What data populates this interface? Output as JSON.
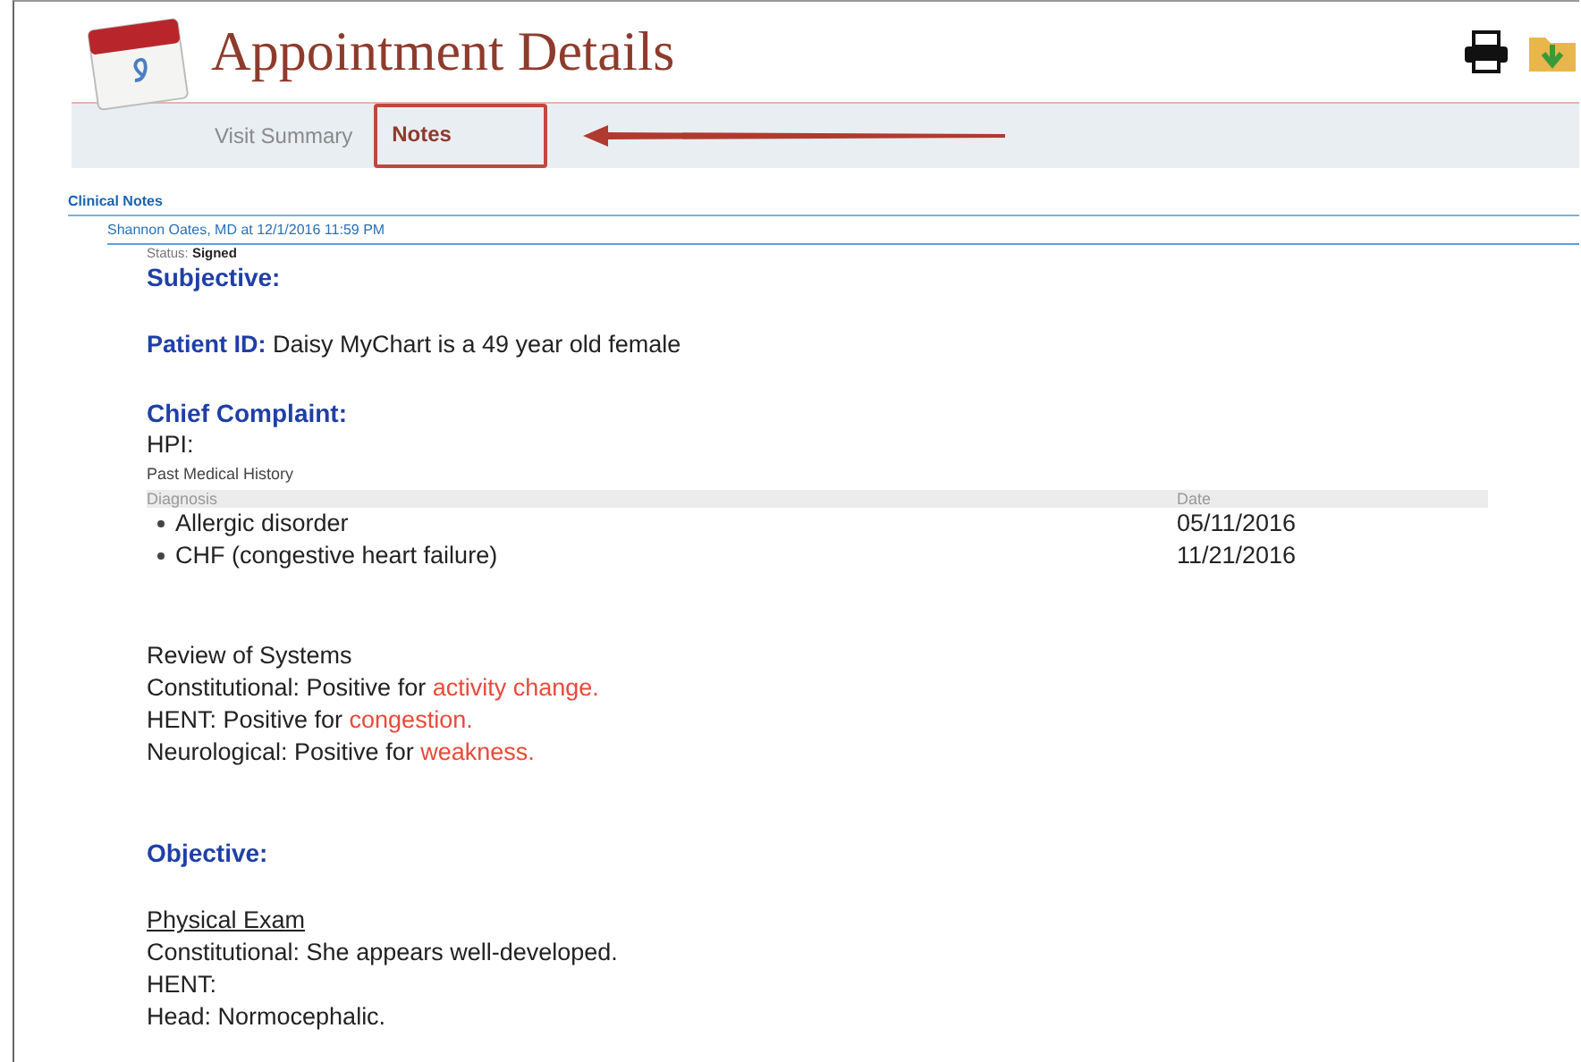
{
  "header": {
    "title": "Appointment Details"
  },
  "tabs": [
    {
      "label": "Visit Summary",
      "selected": false
    },
    {
      "label": "Notes",
      "selected": true
    }
  ],
  "section_title": "Clinical Notes",
  "note": {
    "author": "Shannon Oates, MD at 12/1/2016 11:59 PM",
    "status_label": "Status:",
    "status": "Signed",
    "subjective_heading": "Subjective:",
    "patient_id_label": "Patient ID:",
    "patient_id_text": "Daisy MyChart is a 49 year old female",
    "chief_complaint_heading": "Chief Complaint:",
    "hpi": "HPI:",
    "history_title": "Past Medical History",
    "history_columns": [
      "Diagnosis",
      "Date"
    ],
    "history_rows": [
      {
        "diagnosis": "Allergic disorder",
        "date": "05/11/2016"
      },
      {
        "diagnosis": "CHF (congestive heart failure)",
        "date": "11/21/2016"
      }
    ],
    "review_title": "Review of Systems",
    "review_lines": [
      {
        "text": "Constitutional: Positive for ",
        "finding": "activity change."
      },
      {
        "text": "HENT: Positive for ",
        "finding": "congestion."
      },
      {
        "text": "Neurological: Positive for ",
        "finding": "weakness."
      }
    ],
    "objective_heading": "Objective:",
    "exam_title": "Physical Exam",
    "exam_lines": [
      "Constitutional: She appears well-developed.",
      "HENT:",
      "Head: Normocephalic."
    ]
  }
}
